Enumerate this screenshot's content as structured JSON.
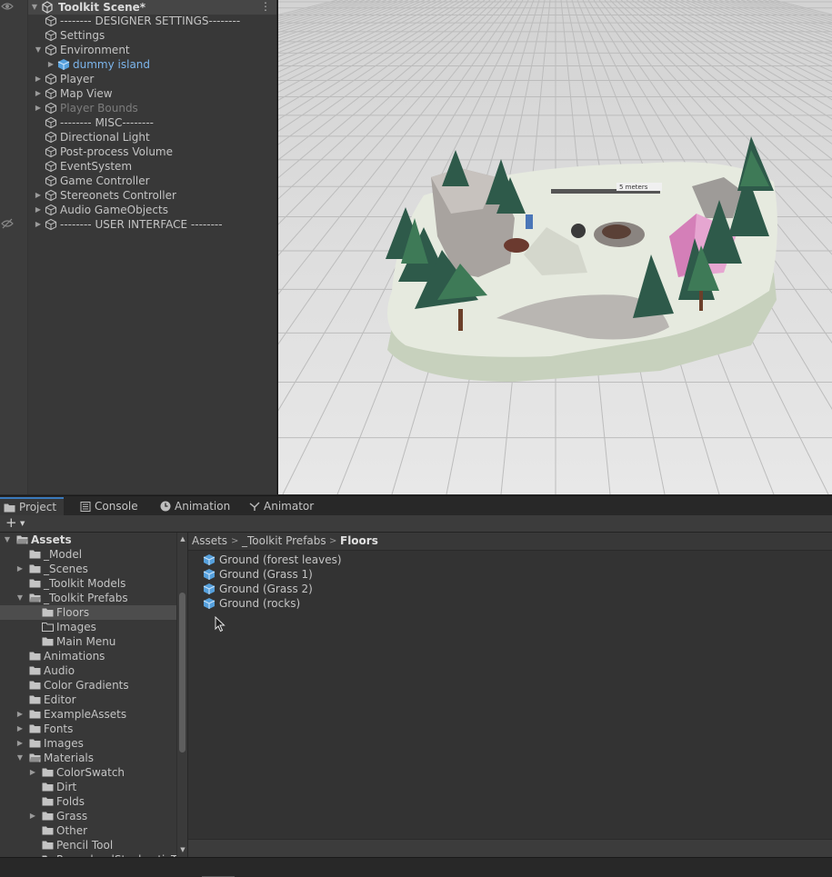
{
  "hierarchy": {
    "scene_name": "Toolkit Scene*",
    "menu_glyph": "⋮",
    "items": [
      {
        "label": "-------- DESIGNER SETTINGS--------"
      },
      {
        "label": "Settings"
      },
      {
        "label": "Environment"
      },
      {
        "label": "dummy island"
      },
      {
        "label": "Player"
      },
      {
        "label": "Map View"
      },
      {
        "label": "Player Bounds"
      },
      {
        "label": "-------- MISC--------"
      },
      {
        "label": "Directional Light"
      },
      {
        "label": "Post-process Volume"
      },
      {
        "label": "EventSystem"
      },
      {
        "label": "Game Controller"
      },
      {
        "label": "Stereonets Controller"
      },
      {
        "label": "Audio GameObjects"
      },
      {
        "label": "-------- USER INTERFACE --------"
      }
    ]
  },
  "scene": {
    "sign_text": "5 meters"
  },
  "tabs": [
    {
      "label": "Project",
      "icon": "folder-icon"
    },
    {
      "label": "Console",
      "icon": "console-icon"
    },
    {
      "label": "Animation",
      "icon": "clock-icon"
    },
    {
      "label": "Animator",
      "icon": "animator-icon"
    }
  ],
  "toolbar": {
    "create_glyph": "+",
    "create_dropdown_glyph": "▼"
  },
  "project_tree": [
    {
      "label": "Assets"
    },
    {
      "label": "_Model"
    },
    {
      "label": "_Scenes"
    },
    {
      "label": "_Toolkit Models"
    },
    {
      "label": "_Toolkit Prefabs"
    },
    {
      "label": "Floors"
    },
    {
      "label": "Images"
    },
    {
      "label": "Main Menu"
    },
    {
      "label": "Animations"
    },
    {
      "label": "Audio"
    },
    {
      "label": "Color Gradients"
    },
    {
      "label": "Editor"
    },
    {
      "label": "ExampleAssets"
    },
    {
      "label": "Fonts"
    },
    {
      "label": "Images"
    },
    {
      "label": "Materials"
    },
    {
      "label": "ColorSwatch"
    },
    {
      "label": "Dirt"
    },
    {
      "label": "Folds"
    },
    {
      "label": "Grass"
    },
    {
      "label": "Other"
    },
    {
      "label": "Pencil Tool"
    },
    {
      "label": "ProceduralStochasticT"
    }
  ],
  "breadcrumb": [
    "Assets",
    "_Toolkit Prefabs",
    "Floors"
  ],
  "assets": [
    {
      "label": "Ground (forest leaves)"
    },
    {
      "label": "Ground (Grass 1)"
    },
    {
      "label": "Ground (Grass 2)"
    },
    {
      "label": "Ground (rocks)"
    }
  ],
  "colors": {
    "selection": "#4d4d4d",
    "prefab_text": "#7cb5ec",
    "prefab_icon": "#56a0dc",
    "tab_accent": "#3a79bb"
  }
}
